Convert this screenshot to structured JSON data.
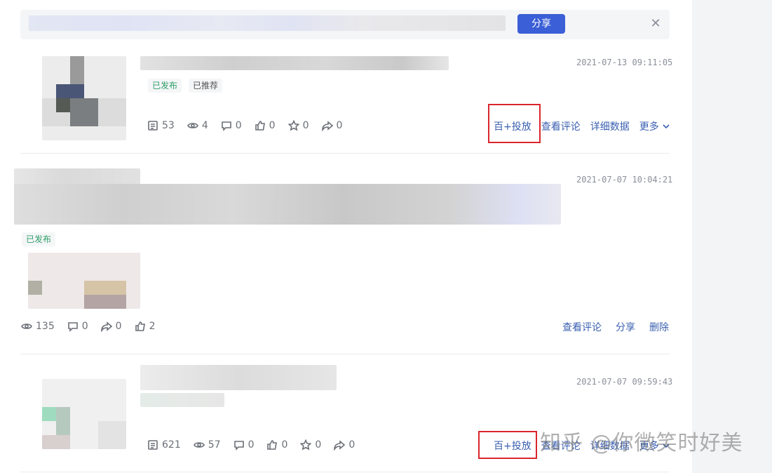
{
  "banner": {
    "share_label": "分享",
    "close_icon": "close-icon"
  },
  "posts": [
    {
      "timestamp": "2021-07-13 09:11:05",
      "badges": [
        "已发布",
        "已推荐"
      ],
      "stats": {
        "reads": "53",
        "views": "4",
        "comments": "0",
        "likes": "0",
        "favorites": "0",
        "shares": "0"
      },
      "actions": {
        "promote": "百+投放",
        "view_comments": "查看评论",
        "details": "详细数据",
        "more": "更多"
      }
    },
    {
      "timestamp": "2021-07-07 10:04:21",
      "badges": [
        "已发布"
      ],
      "stats": {
        "views": "135",
        "comments": "0",
        "shares": "0",
        "likes": "2"
      },
      "actions": {
        "view_comments": "查看评论",
        "share": "分享",
        "delete": "删除"
      }
    },
    {
      "timestamp": "2021-07-07 09:59:43",
      "stats": {
        "reads": "621",
        "views": "57",
        "comments": "0",
        "likes": "0",
        "favorites": "0",
        "shares": "0"
      },
      "actions": {
        "promote": "百+投放",
        "view_comments": "查看评论",
        "details": "详细数据",
        "more": "更多"
      }
    }
  ],
  "watermark": "知乎 @你微笑时好美",
  "colors": {
    "accent": "#3a5fd6",
    "link": "#3a5fb0",
    "highlight": "#d9262c",
    "badge_green": "#2f9e6a"
  }
}
